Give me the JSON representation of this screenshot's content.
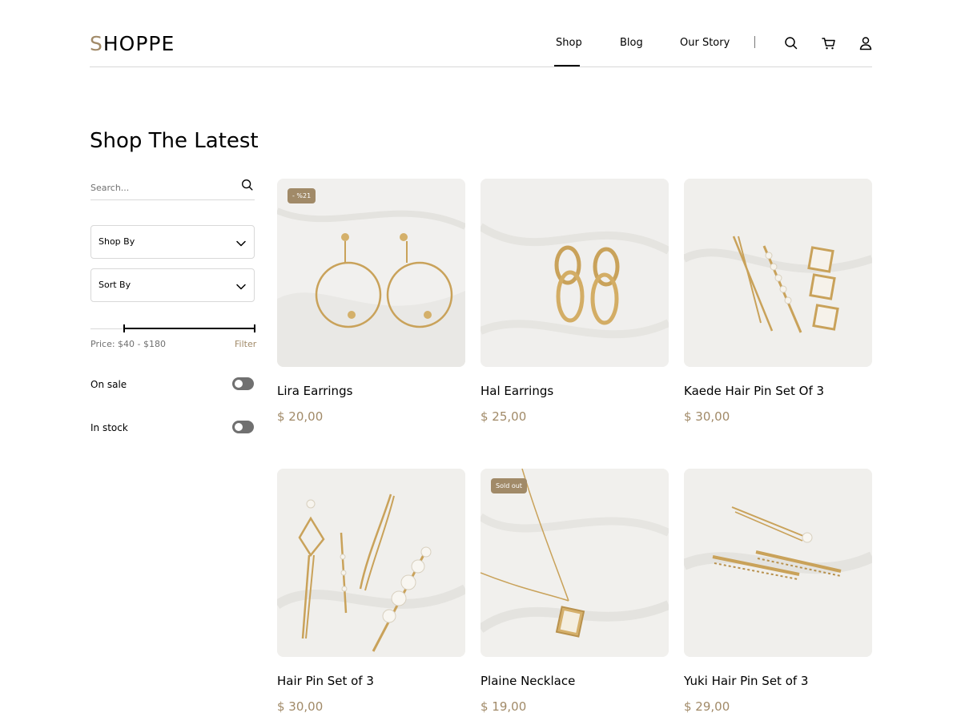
{
  "brand": {
    "logo_first": "S",
    "logo_rest": "HOPPE"
  },
  "nav": {
    "items": [
      {
        "label": "Shop"
      },
      {
        "label": "Blog"
      },
      {
        "label": "Our Story"
      }
    ],
    "active": "Shop"
  },
  "header_icons": [
    "search-icon",
    "cart-icon",
    "user-icon"
  ],
  "page_title": "Shop The Latest",
  "sidebar": {
    "search_placeholder": "Search...",
    "shop_by_label": "Shop By",
    "sort_by_label": "Sort By",
    "price_text": "Price: $40 - $180",
    "price_min": 40,
    "price_max": 180,
    "filter_label": "Filter",
    "on_sale_label": "On sale",
    "on_sale_on": false,
    "in_stock_label": "In stock",
    "in_stock_on": false
  },
  "products": [
    {
      "name": "Lira Earrings",
      "price": "$ 20,00",
      "badge": "- %21"
    },
    {
      "name": "Hal Earrings",
      "price": "$ 25,00",
      "badge": ""
    },
    {
      "name": "Kaede Hair Pin Set Of 3",
      "price": "$ 30,00",
      "badge": ""
    },
    {
      "name": "Hair Pin Set of 3",
      "price": "$ 30,00",
      "badge": ""
    },
    {
      "name": "Plaine Necklace",
      "price": "$ 19,00",
      "badge": "Sold out"
    },
    {
      "name": "Yuki Hair Pin Set of 3",
      "price": "$ 29,00",
      "badge": ""
    }
  ],
  "colors": {
    "accent": "#a18a68",
    "text": "#000000",
    "muted": "#707070",
    "border": "#d8d8d8",
    "gold": "#c9a25a"
  }
}
